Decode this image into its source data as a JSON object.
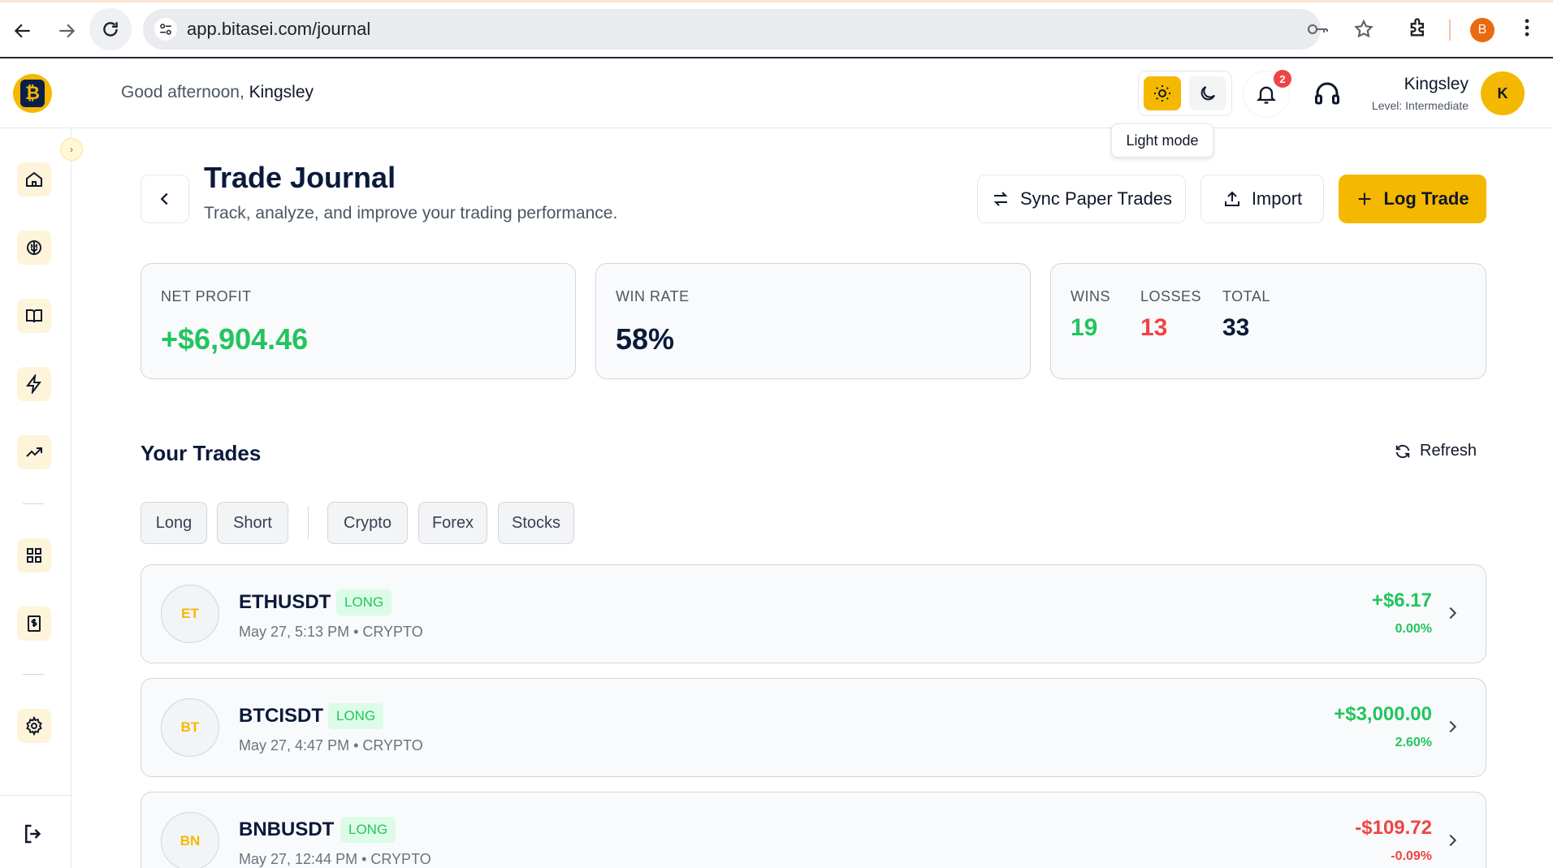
{
  "browser": {
    "url": "app.bitasei.com/journal",
    "profile_initial": "B"
  },
  "header": {
    "greeting_prefix": "Good afternoon, ",
    "greeting_name": "Kingsley",
    "notification_count": "2",
    "user_name": "Kingsley",
    "user_level": "Level: Intermediate",
    "avatar_initial": "K",
    "tooltip": "Light mode"
  },
  "page": {
    "title": "Trade Journal",
    "subtitle": "Track, analyze, and improve your trading performance.",
    "actions": {
      "sync": "Sync Paper Trades",
      "import": "Import",
      "log": "Log Trade"
    }
  },
  "stats": {
    "net_profit_label": "NET PROFIT",
    "net_profit_value": "+$6,904.46",
    "win_rate_label": "WIN RATE",
    "win_rate_value": "58%",
    "wins_label": "WINS",
    "wins_value": "19",
    "losses_label": "LOSSES",
    "losses_value": "13",
    "total_label": "TOTAL",
    "total_value": "33"
  },
  "trades_section": {
    "title": "Your Trades",
    "refresh": "Refresh",
    "filters": [
      "Long",
      "Short",
      "Crypto",
      "Forex",
      "Stocks"
    ]
  },
  "trades": [
    {
      "initials": "ET",
      "symbol": "ETHUSDT",
      "side": "LONG",
      "meta": "May 27, 5:13 PM • CRYPTO",
      "pnl": "+$6.17",
      "pct": "0.00%",
      "positive": true
    },
    {
      "initials": "BT",
      "symbol": "BTCISDT",
      "side": "LONG",
      "meta": "May 27, 4:47 PM • CRYPTO",
      "pnl": "+$3,000.00",
      "pct": "2.60%",
      "positive": true
    },
    {
      "initials": "BN",
      "symbol": "BNBUSDT",
      "side": "LONG",
      "meta": "May 27, 12:44 PM • CRYPTO",
      "pnl": "-$109.72",
      "pct": "-0.09%",
      "positive": false
    }
  ],
  "colors": {
    "accent": "#f5b800",
    "positive": "#22c55e",
    "negative": "#ef4444",
    "navy": "#0b1a3a"
  }
}
